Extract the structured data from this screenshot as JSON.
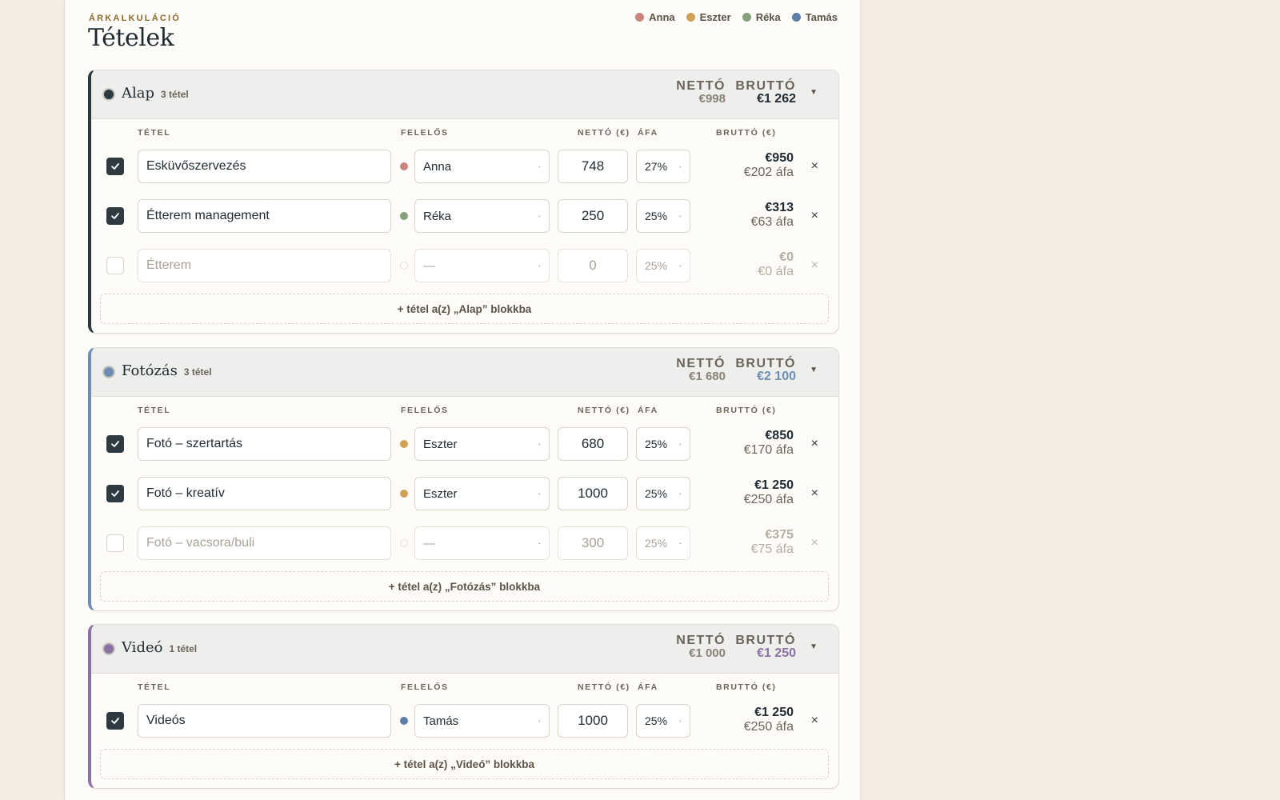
{
  "header": {
    "kicker": "ÁRKALKULÁCIÓ",
    "title": "Tételek"
  },
  "legend": [
    {
      "name": "Anna",
      "color": "#c9857c"
    },
    {
      "name": "Eszter",
      "color": "#cfa257"
    },
    {
      "name": "Réka",
      "color": "#86a07d"
    },
    {
      "name": "Tamás",
      "color": "#5d7ea6"
    }
  ],
  "columns": {
    "item": "TÉTEL",
    "owner": "FELELŐS",
    "net": "NETTÓ (€)",
    "vat": "ÁFA",
    "gross": "BRUTTÓ (€)"
  },
  "sum_labels": {
    "net": "NETTÓ",
    "gross": "BRUTTÓ"
  },
  "blocks": [
    {
      "name": "Alap",
      "count": "3 tétel",
      "net_total": "€998",
      "gross_total": "€1 262",
      "accent": "#2d3a42",
      "dot": "#2d3a42",
      "add_label": "+ tétel a(z) „Alap” blokkba",
      "rows": [
        {
          "checked": true,
          "name": "Esküvőszervezés",
          "owner": "Anna",
          "owner_color": "#c9857c",
          "net": "748",
          "vat": "27%",
          "gross": "€950",
          "vat_amount": "€202 áfa"
        },
        {
          "checked": true,
          "name": "Étterem management",
          "owner": "Réka",
          "owner_color": "#86a07d",
          "net": "250",
          "vat": "25%",
          "gross": "€313",
          "vat_amount": "€63 áfa"
        },
        {
          "checked": false,
          "name": "Étterem",
          "owner": "—",
          "owner_color": "",
          "net": "0",
          "vat": "25%",
          "gross": "€0",
          "vat_amount": "€0 áfa"
        }
      ]
    },
    {
      "name": "Fotózás",
      "count": "3 tétel",
      "net_total": "€1 680",
      "gross_total": "€2 100",
      "accent": "#6e8fb3",
      "dot": "#6e8fb3",
      "add_label": "+ tétel a(z) „Fotózás” blokkba",
      "rows": [
        {
          "checked": true,
          "name": "Fotó – szertartás",
          "owner": "Eszter",
          "owner_color": "#cfa257",
          "net": "680",
          "vat": "25%",
          "gross": "€850",
          "vat_amount": "€170 áfa"
        },
        {
          "checked": true,
          "name": "Fotó – kreatív",
          "owner": "Eszter",
          "owner_color": "#cfa257",
          "net": "1000",
          "vat": "25%",
          "gross": "€1 250",
          "vat_amount": "€250 áfa"
        },
        {
          "checked": false,
          "name": "Fotó – vacsora/buli",
          "owner": "—",
          "owner_color": "",
          "net": "300",
          "vat": "25%",
          "gross": "€375",
          "vat_amount": "€75 áfa"
        }
      ]
    },
    {
      "name": "Videó",
      "count": "1 tétel",
      "net_total": "€1 000",
      "gross_total": "€1 250",
      "accent": "#8c73a6",
      "dot": "#8c73a6",
      "add_label": "+ tétel a(z) „Videó” blokkba",
      "rows": [
        {
          "checked": true,
          "name": "Videós",
          "owner": "Tamás",
          "owner_color": "#5d7ea6",
          "net": "1000",
          "vat": "25%",
          "gross": "€1 250",
          "vat_amount": "€250 áfa"
        }
      ]
    }
  ]
}
